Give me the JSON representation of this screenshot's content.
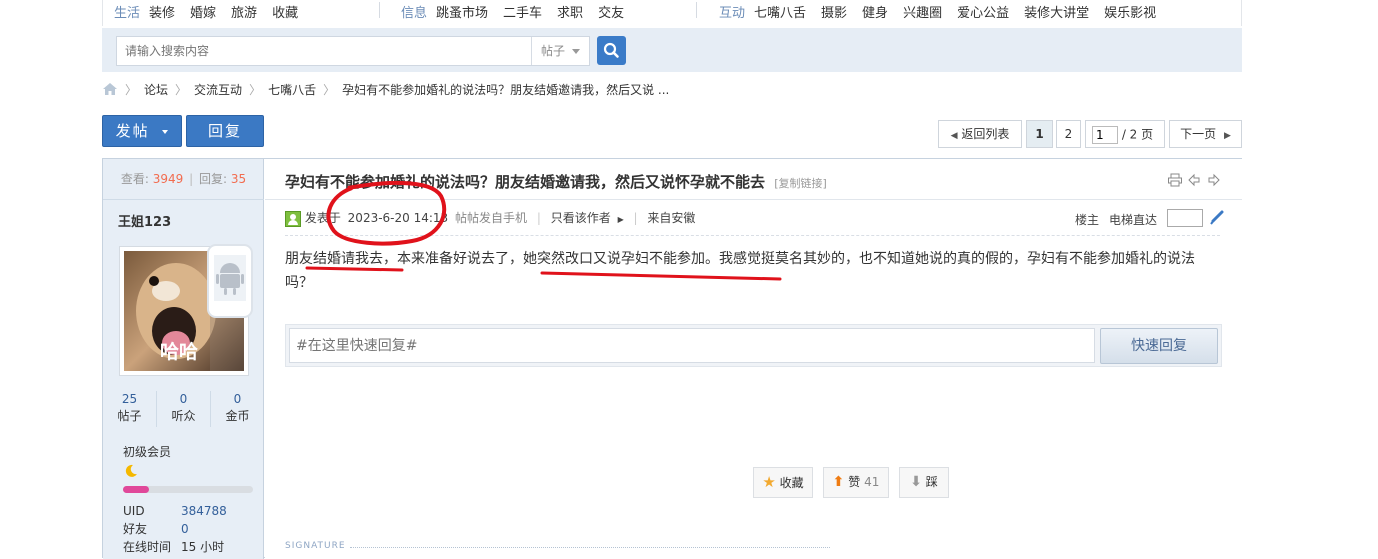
{
  "topnav": {
    "group1": {
      "label": "生活",
      "items": [
        "装修",
        "婚嫁",
        "旅游",
        "收藏"
      ]
    },
    "group2": {
      "label": "信息",
      "items": [
        "跳蚤市场",
        "二手车",
        "求职",
        "交友"
      ]
    },
    "group3": {
      "label": "互动",
      "items": [
        "七嘴八舌",
        "摄影",
        "健身",
        "兴趣圈",
        "爱心公益",
        "装修大讲堂",
        "娱乐影视"
      ]
    }
  },
  "search": {
    "placeholder": "请输入搜索内容",
    "type": "帖子"
  },
  "breadcrumb": {
    "items": [
      "论坛",
      "交流互动",
      "七嘴八舌",
      "孕妇有不能参加婚礼的说法吗？朋友结婚邀请我，然后又说 ..."
    ]
  },
  "actions": {
    "post": "发帖",
    "reply": "回复"
  },
  "pager": {
    "back": "返回列表",
    "page1": "1",
    "page2": "2",
    "input": "1",
    "total": "/ 2 页",
    "next": "下一页"
  },
  "stats": {
    "views_label": "查看:",
    "views": "3949",
    "sep": "|",
    "replies_label": "回复:",
    "replies": "35"
  },
  "author": {
    "name": "王姐123",
    "avatar_text": "哈哈",
    "posts": "25",
    "posts_label": "帖子",
    "followers": "0",
    "followers_label": "听众",
    "coins": "0",
    "coins_label": "金币",
    "level": "初级会员",
    "uid_label": "UID",
    "uid": "384788",
    "friends_label": "好友",
    "friends": "0",
    "online_label": "在线时间",
    "online": "15 小时"
  },
  "post": {
    "title": "孕妇有不能参加婚礼的说法吗？朋友结婚邀请我，然后又说怀孕就不能去",
    "copy_link": "[复制链接]",
    "posted_label": "发表于",
    "posted_time": "2023-6-20 14:13",
    "from_mobile": "帖帖发自手机",
    "only_author": "只看该作者",
    "location": "来自安徽",
    "floor": "楼主",
    "jump_label": "电梯直达",
    "body": "朋友结婚请我去，本来准备好说去了，她突然改口又说孕妇不能参加。我感觉挺莫名其妙的，也不知道她说的真的假的，孕妇有不能参加婚礼的说法吗？",
    "quick_reply_placeholder": "#在这里快速回复#",
    "quick_reply_btn": "快速回复",
    "fav": "收藏",
    "like": "赞",
    "like_count": "41",
    "dislike": "踩",
    "signature": "SIGNATURE"
  },
  "colors": {
    "accent": "#3b79c4",
    "annotation": "#e0121b",
    "count": "#f26c4f"
  }
}
